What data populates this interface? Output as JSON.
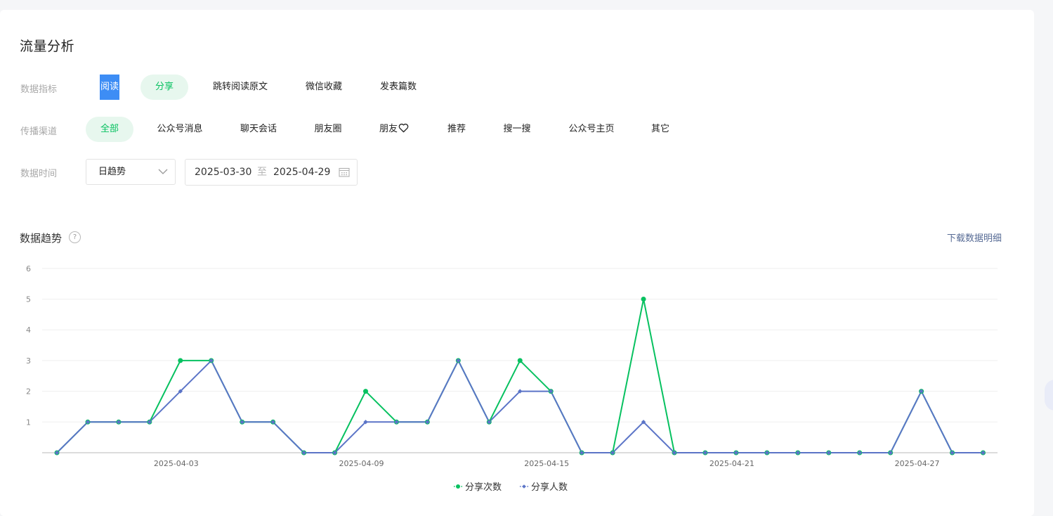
{
  "page": {
    "title": "流量分析"
  },
  "filters": {
    "metric": {
      "label": "数据指标",
      "options": [
        "阅读",
        "分享",
        "跳转阅读原文",
        "微信收藏",
        "发表篇数"
      ]
    },
    "channel": {
      "label": "传播渠道",
      "options": [
        "全部",
        "公众号消息",
        "聊天会话",
        "朋友圈",
        "朋友",
        "推荐",
        "搜一搜",
        "公众号主页",
        "其它"
      ]
    },
    "time": {
      "label": "数据时间",
      "mode": "日趋势",
      "start": "2025-03-30",
      "separator": "至",
      "end": "2025-04-29"
    }
  },
  "trend": {
    "title": "数据趋势",
    "help_glyph": "?",
    "download_label": "下载数据明细"
  },
  "colors": {
    "green": "#07c160",
    "blue": "#5b74c7",
    "link": "#576b95"
  },
  "chart_data": {
    "type": "line",
    "x": [
      "2025-03-30",
      "2025-03-31",
      "2025-04-01",
      "2025-04-02",
      "2025-04-03",
      "2025-04-04",
      "2025-04-05",
      "2025-04-06",
      "2025-04-07",
      "2025-04-08",
      "2025-04-09",
      "2025-04-10",
      "2025-04-11",
      "2025-04-12",
      "2025-04-13",
      "2025-04-14",
      "2025-04-15",
      "2025-04-16",
      "2025-04-17",
      "2025-04-18",
      "2025-04-19",
      "2025-04-20",
      "2025-04-21",
      "2025-04-22",
      "2025-04-23",
      "2025-04-24",
      "2025-04-25",
      "2025-04-26",
      "2025-04-27",
      "2025-04-28",
      "2025-04-29"
    ],
    "xticks": [
      "2025-04-03",
      "2025-04-09",
      "2025-04-15",
      "2025-04-21",
      "2025-04-27"
    ],
    "yticks": [
      "1",
      "2",
      "3",
      "4",
      "5",
      "6"
    ],
    "ylim": [
      0,
      6
    ],
    "grid": true,
    "legend": "bottom-center",
    "series": [
      {
        "name": "分享次数",
        "color": "#07c160",
        "values": [
          0,
          1,
          1,
          1,
          3,
          3,
          1,
          1,
          0,
          0,
          2,
          1,
          1,
          3,
          1,
          3,
          2,
          0,
          0,
          5,
          0,
          0,
          0,
          0,
          0,
          0,
          0,
          0,
          2,
          0,
          0
        ]
      },
      {
        "name": "分享人数",
        "color": "#5b74c7",
        "values": [
          0,
          1,
          1,
          1,
          2,
          3,
          1,
          1,
          0,
          0,
          1,
          1,
          1,
          3,
          1,
          2,
          2,
          0,
          0,
          1,
          0,
          0,
          0,
          0,
          0,
          0,
          0,
          0,
          2,
          0,
          0
        ]
      }
    ]
  }
}
